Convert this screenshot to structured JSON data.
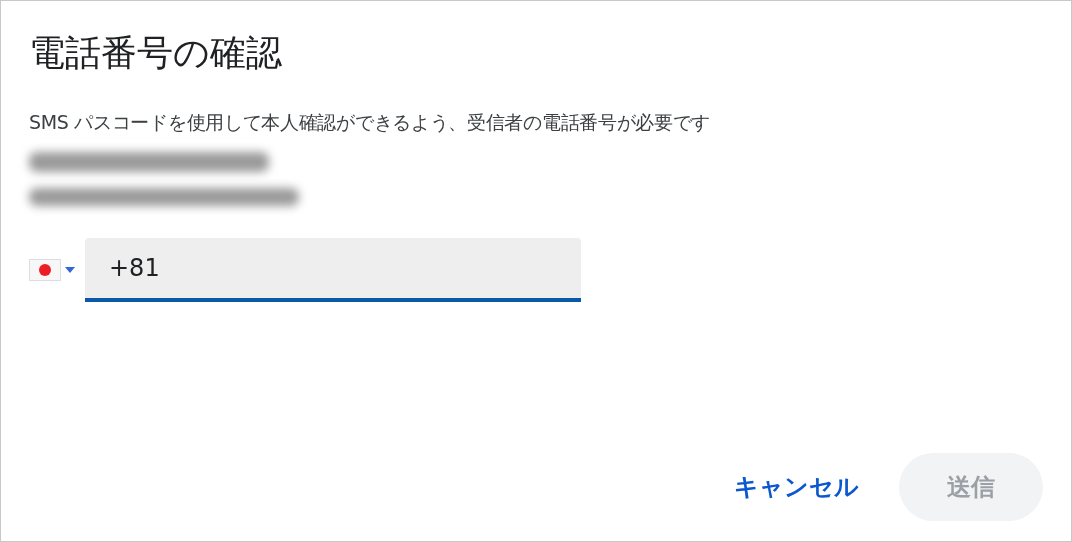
{
  "dialog": {
    "title": "電話番号の確認",
    "description": "SMS パスコードを使用して本人確認ができるよう、受信者の電話番号が必要です",
    "recipient": {
      "blurred": true
    },
    "phone": {
      "value": "+81",
      "focused": true
    },
    "buttons": [
      {
        "label": "キャンセル",
        "kind": "text",
        "disabled": false
      },
      {
        "label": "送信",
        "kind": "filled",
        "disabled": true
      }
    ]
  }
}
